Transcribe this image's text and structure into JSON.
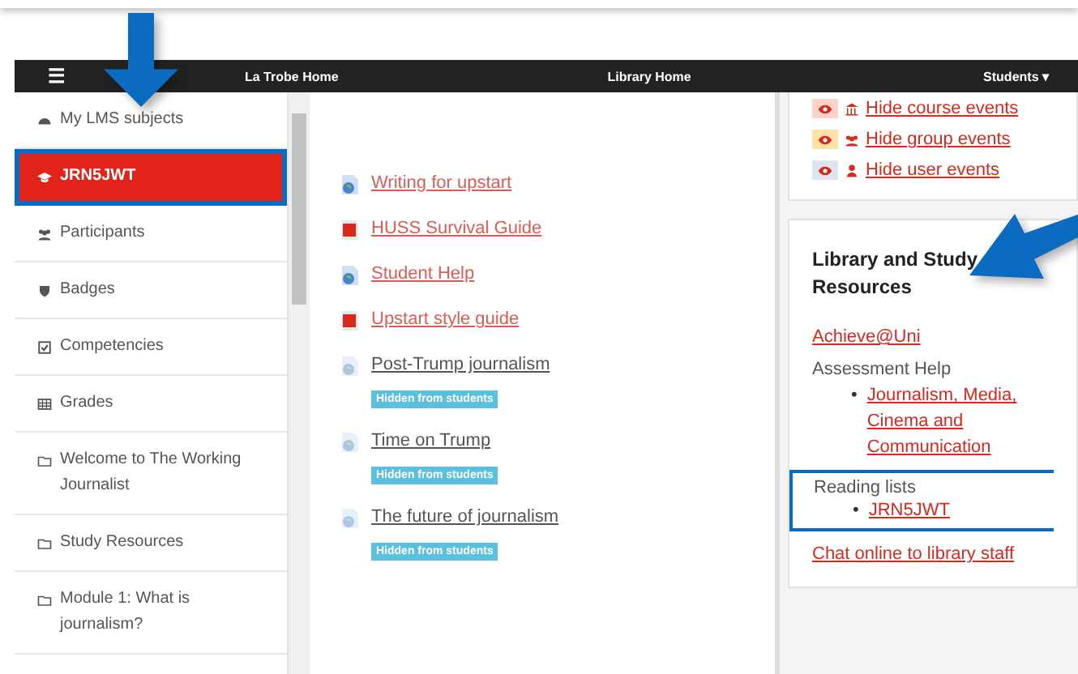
{
  "navbar": {
    "menu_icon": "☰",
    "links": [
      "La Trobe Home",
      "Library Home"
    ],
    "user_menu": "Students",
    "user_caret": "▾"
  },
  "sidebar": {
    "items": [
      {
        "label": "My LMS subjects",
        "kind": "dashboard",
        "selected": false
      },
      {
        "label": "JRN5JWT",
        "kind": "cap",
        "selected": true
      },
      {
        "label": "Participants",
        "kind": "users",
        "selected": false
      },
      {
        "label": "Badges",
        "kind": "shield",
        "selected": false
      },
      {
        "label": "Competencies",
        "kind": "check",
        "selected": false
      },
      {
        "label": "Grades",
        "kind": "table",
        "selected": false
      },
      {
        "label": "Welcome to The Working Journalist",
        "kind": "folder",
        "selected": false
      },
      {
        "label": "Study Resources",
        "kind": "folder",
        "selected": false
      },
      {
        "label": "Module 1: What is journalism?",
        "kind": "folder",
        "selected": false
      }
    ]
  },
  "content": {
    "items": [
      {
        "label": "Writing for upstart",
        "kind": "url",
        "hidden": false
      },
      {
        "label": "HUSS Survival Guide",
        "kind": "pdf",
        "hidden": false
      },
      {
        "label": "Student Help",
        "kind": "url",
        "hidden": false
      },
      {
        "label": "Upstart style guide",
        "kind": "pdf",
        "hidden": false
      },
      {
        "label": "Post-Trump journalism",
        "kind": "url",
        "hidden": true,
        "badge": "Hidden from students"
      },
      {
        "label": "Time on Trump",
        "kind": "url",
        "hidden": true,
        "badge": "Hidden from students"
      },
      {
        "label": "The future of journalism",
        "kind": "url",
        "hidden": true,
        "badge": "Hidden from students"
      }
    ]
  },
  "events": [
    {
      "label": "Hide course events",
      "kind": "course",
      "color": "#fbd3c9"
    },
    {
      "label": "Hide group events",
      "kind": "group",
      "color": "#fde3a7"
    },
    {
      "label": "Hide user events",
      "kind": "user",
      "color": "#dde6ee"
    }
  ],
  "library": {
    "title": "Library and Study Resources",
    "link": "Achieve@Uni",
    "assessment": {
      "heading": "Assessment Help",
      "items": [
        {
          "bullet": "•",
          "label": "Journalism, Media, Cinema and Communication"
        }
      ]
    },
    "reading": {
      "heading": "Reading lists",
      "items": [
        {
          "bullet": "•",
          "label": "JRN5JWT"
        }
      ]
    },
    "chat": "Chat online to library staff"
  }
}
